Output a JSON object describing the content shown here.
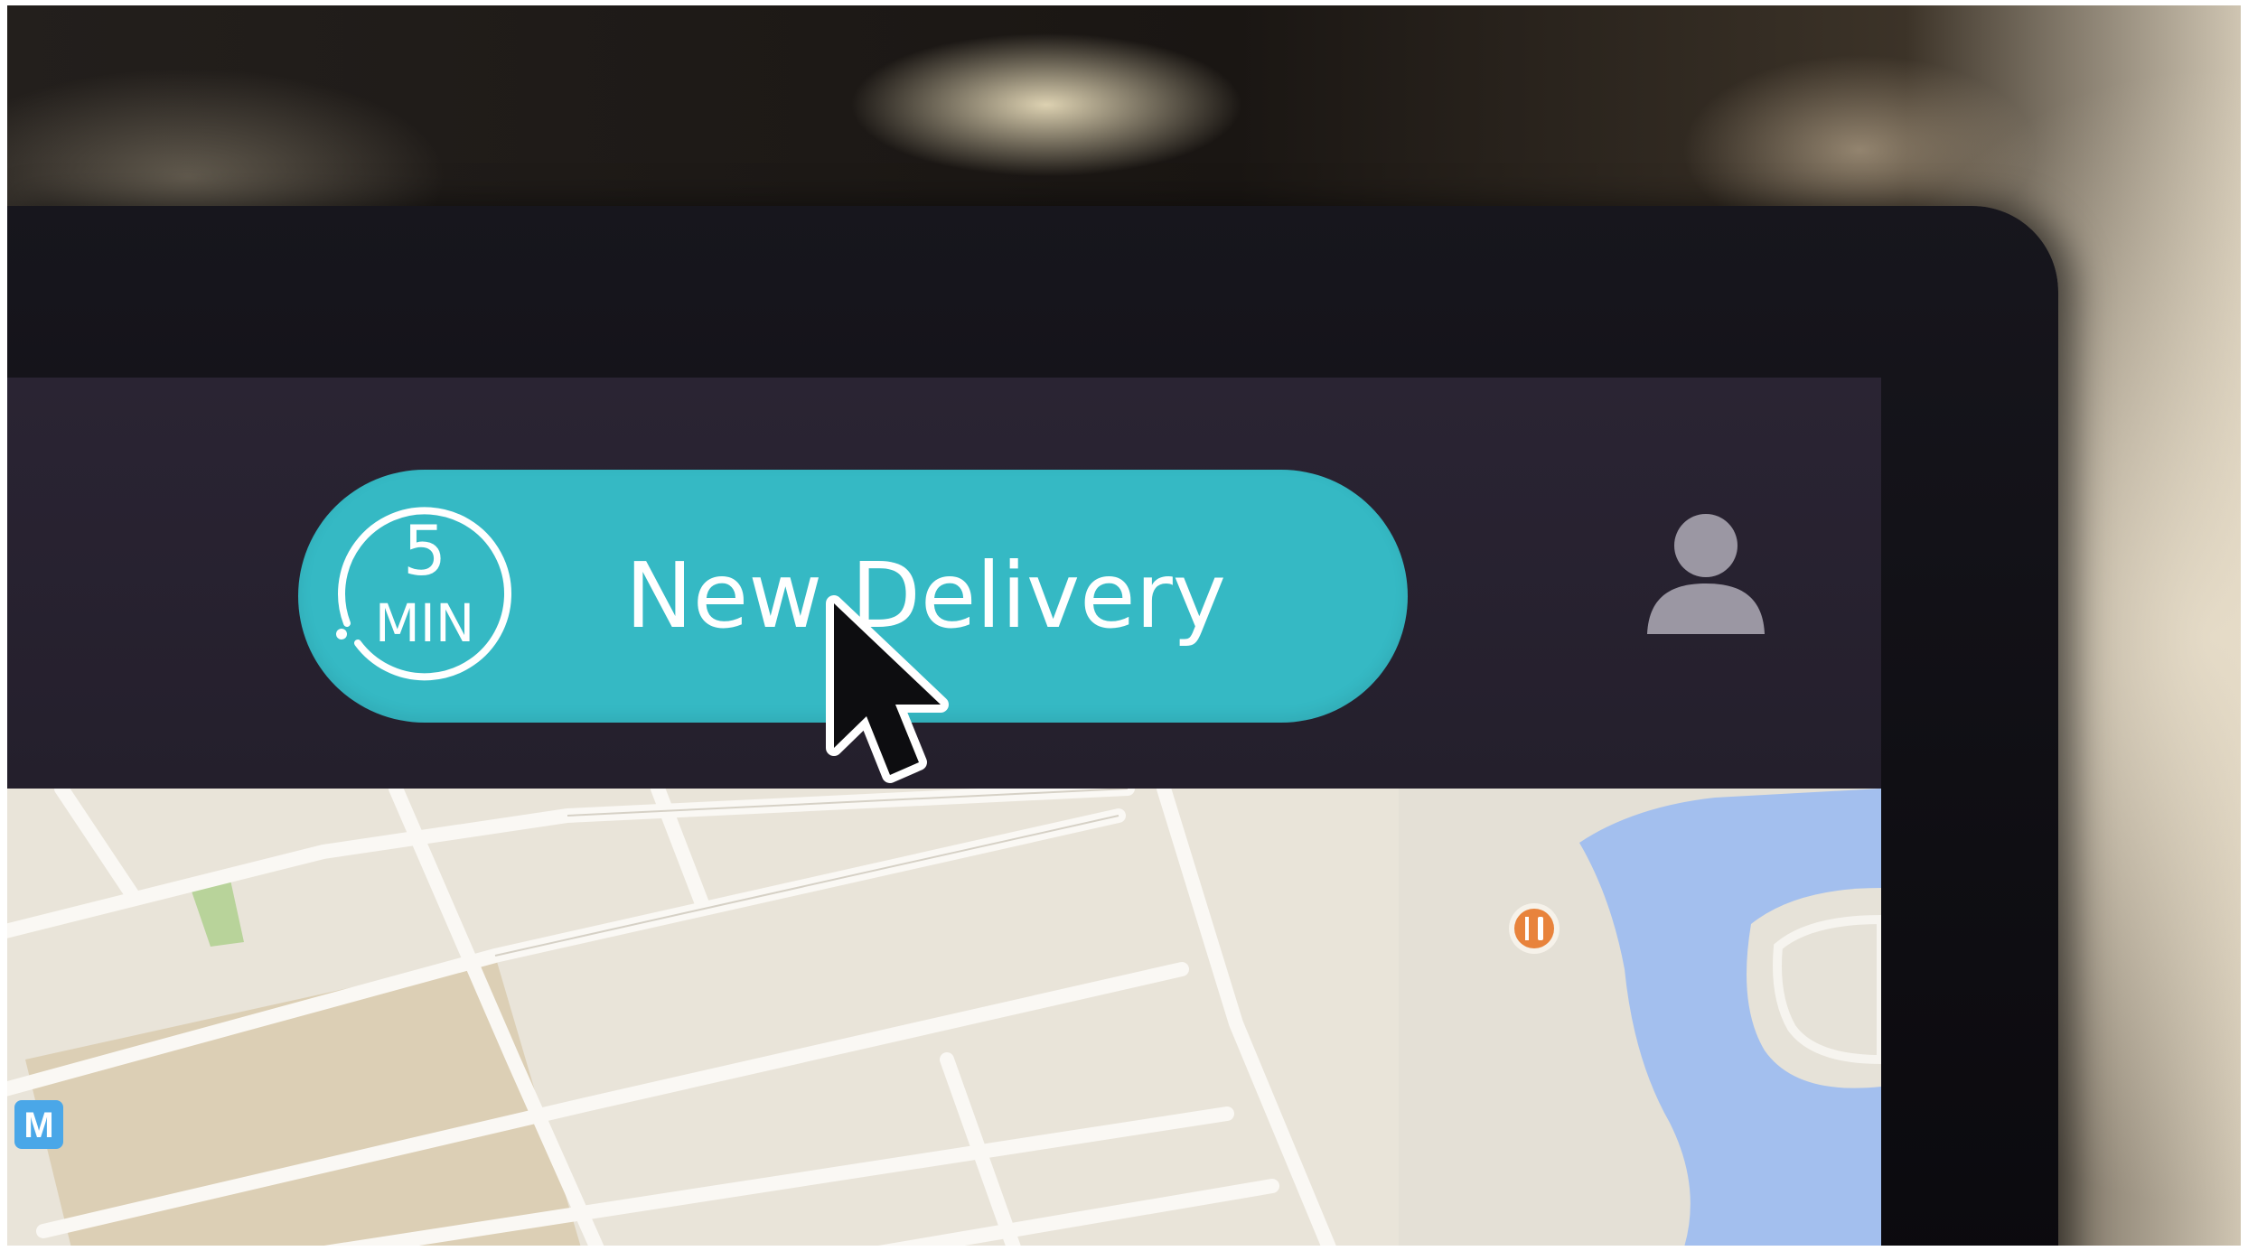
{
  "delivery_button": {
    "timer_value": "5",
    "timer_unit": "MIN",
    "label": "New Delivery"
  },
  "map": {
    "poi_icon": "restaurant-icon",
    "transit_badge": "M"
  },
  "icons": {
    "profile": "user-profile-icon",
    "cursor": "mouse-pointer-icon"
  },
  "colors": {
    "accent": "#35b9c4",
    "topbar": "#27212f",
    "map_land": "#e9e4d9",
    "map_water": "#a3bfee",
    "transit": "#4aa7e8",
    "poi": "#e8833c"
  }
}
